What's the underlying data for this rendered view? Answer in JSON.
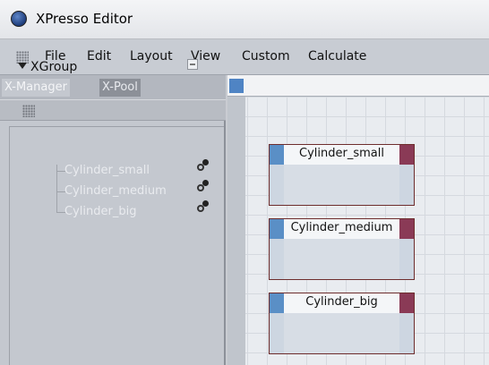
{
  "window": {
    "title": "XPresso Editor"
  },
  "menu": [
    "File",
    "Edit",
    "Layout",
    "View",
    "Custom",
    "Calculate"
  ],
  "left_panel": {
    "tabs": [
      "X-Manager",
      "X-Pool"
    ],
    "tree": {
      "root": "XGroup",
      "children": [
        "Cylinder_small",
        "Cylinder_medium",
        "Cylinder_big"
      ]
    }
  },
  "nodes": [
    "Cylinder_small",
    "Cylinder_medium",
    "Cylinder_big"
  ]
}
